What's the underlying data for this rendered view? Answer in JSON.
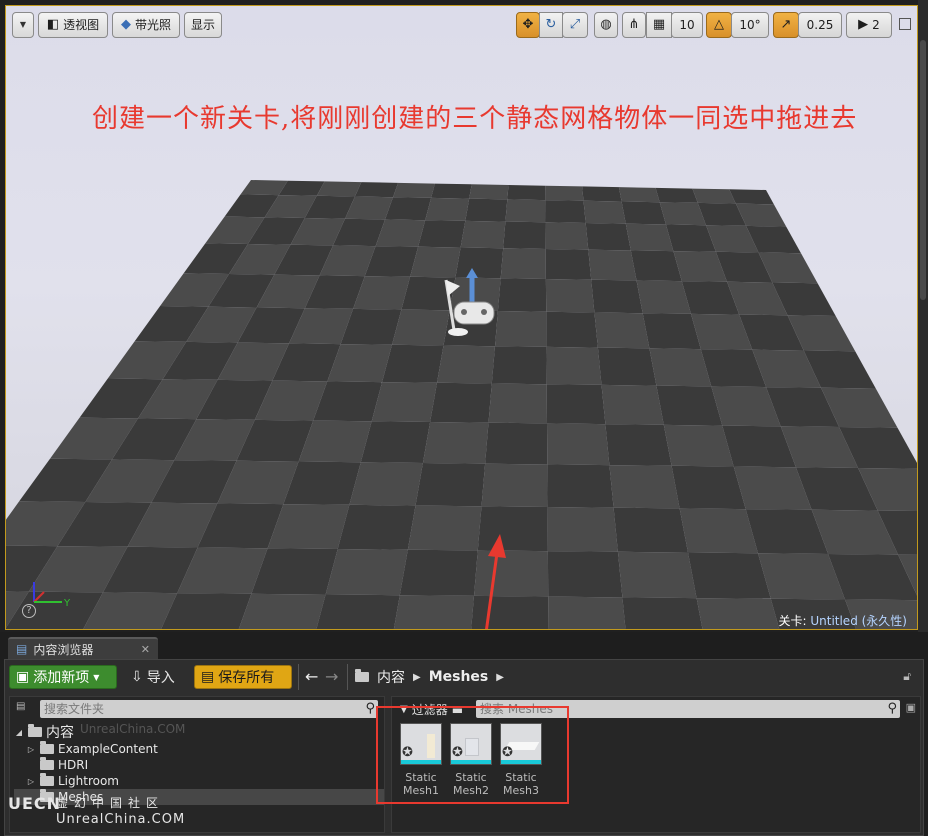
{
  "toolbar": {
    "perspective": "透视图",
    "lit": "带光照",
    "show": "显示",
    "grid_snap": "10",
    "rotation_snap": "10°",
    "scale_snap": "0.25",
    "camera_speed": "2"
  },
  "annotation": "创建一个新关卡,将刚刚创建的三个静态网格物体一同选中拖进去",
  "viewport": {
    "level_prefix": "关卡:",
    "level_name": "Untitled (永久性)",
    "axis_y": "Y",
    "help": "?"
  },
  "content_browser": {
    "tab_label": "内容浏览器",
    "add_new": "添加新项",
    "import": "导入",
    "save_all": "保存所有",
    "breadcrumb": [
      "内容",
      "Meshes"
    ],
    "folder_search_placeholder": "搜索文件夹",
    "asset_search_placeholder": "搜索 Meshes",
    "filter": "过滤器",
    "tree": {
      "root": "内容",
      "children": [
        "ExampleContent",
        "HDRI",
        "Lightroom",
        "Meshes"
      ]
    },
    "assets": [
      {
        "line1": "Static",
        "line2": "Mesh1"
      },
      {
        "line1": "Static",
        "line2": "Mesh2"
      },
      {
        "line1": "Static",
        "line2": "Mesh3"
      }
    ]
  },
  "watermark": {
    "logo": "UECN",
    "chinese": "虚幻中国社区",
    "english": "UnrealChina.COM",
    "faint": "UnrealChina.COM"
  },
  "colors": {
    "annotation_red": "#e8392f",
    "add_green": "#3d8c2e",
    "save_yellow": "#e0a614",
    "selection_gold": "#c29a1d"
  }
}
